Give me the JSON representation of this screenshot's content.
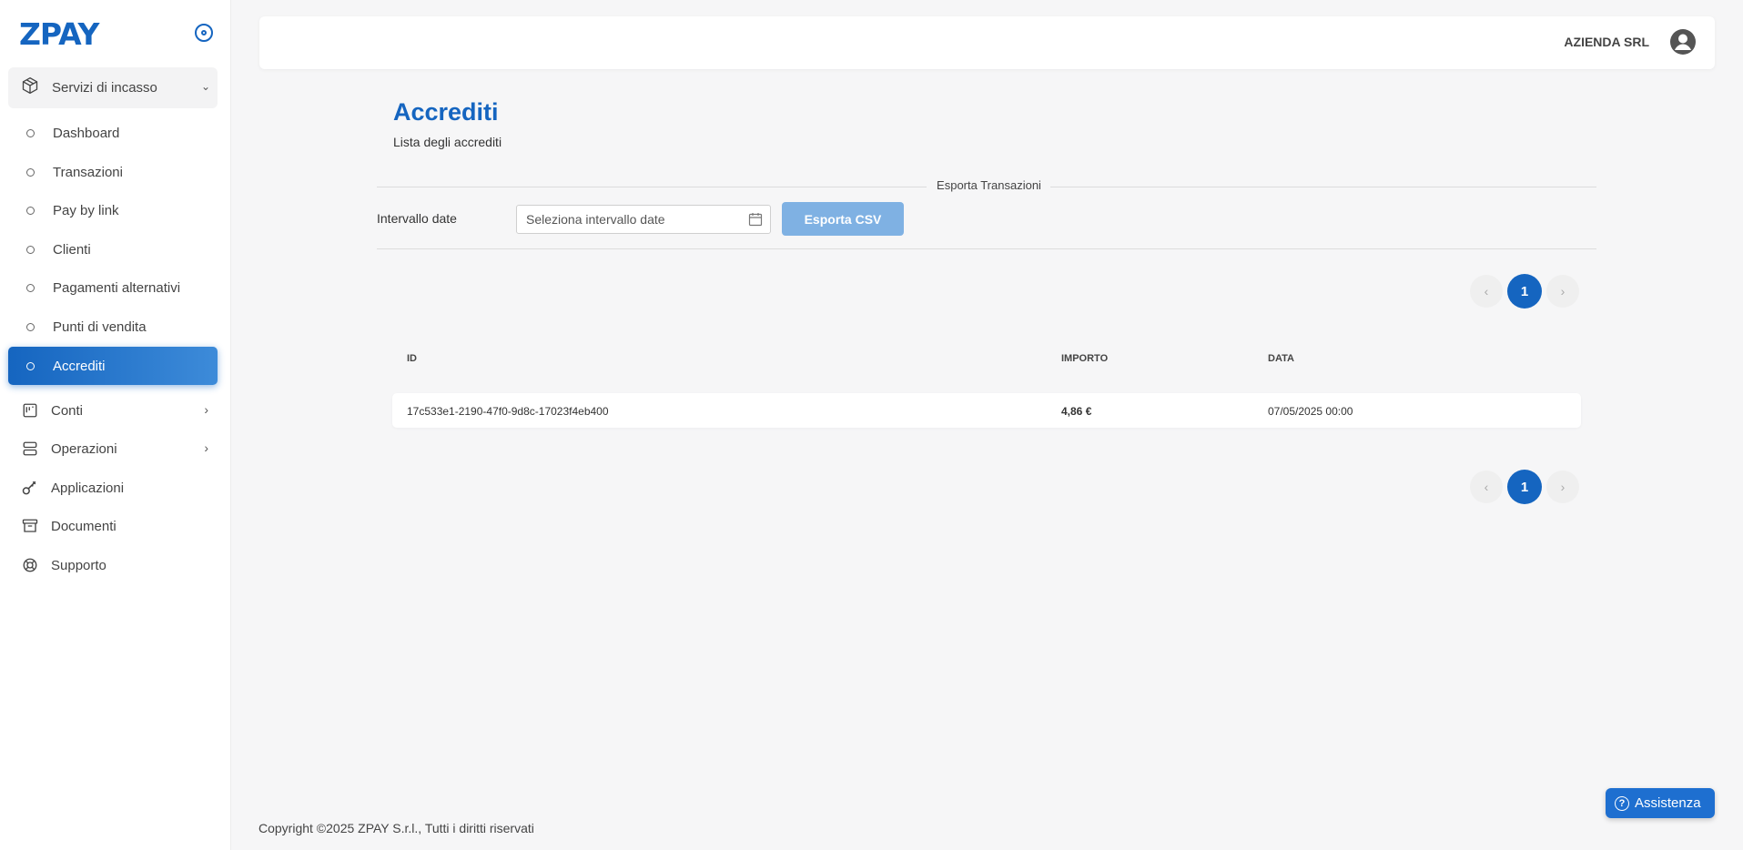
{
  "app": {
    "logo_text": "ZPAY"
  },
  "sidebar": {
    "group": {
      "label": "Servizi di incasso",
      "icon": "box-icon"
    },
    "subitems": [
      {
        "label": "Dashboard"
      },
      {
        "label": "Transazioni"
      },
      {
        "label": "Pay by link"
      },
      {
        "label": "Clienti"
      },
      {
        "label": "Pagamenti alternativi"
      },
      {
        "label": "Punti di vendita"
      },
      {
        "label": "Accrediti",
        "active": true
      }
    ],
    "items": [
      {
        "label": "Conti",
        "icon": "board-icon",
        "has_submenu": true
      },
      {
        "label": "Operazioni",
        "icon": "server-icon",
        "has_submenu": true
      },
      {
        "label": "Applicazioni",
        "icon": "key-icon"
      },
      {
        "label": "Documenti",
        "icon": "archive-icon"
      },
      {
        "label": "Supporto",
        "icon": "lifebuoy-icon"
      }
    ]
  },
  "header": {
    "user_name": "AZIENDA SRL"
  },
  "page": {
    "title": "Accrediti",
    "subtitle": "Lista degli accrediti",
    "export_section_title": "Esporta Transazioni",
    "date_range_label": "Intervallo date",
    "date_range_placeholder": "Seleziona intervallo date",
    "export_button": "Esporta CSV"
  },
  "pagination": {
    "current_page": "1",
    "prev": "‹",
    "next": "›"
  },
  "table": {
    "columns": [
      "ID",
      "IMPORTO",
      "DATA"
    ],
    "rows": [
      {
        "id": "17c533e1-2190-47f0-9d8c-17023f4eb400",
        "importo": "4,86 €",
        "data": "07/05/2025 00:00"
      }
    ]
  },
  "footer": {
    "copyright": "Copyright ©2025 ZPAY S.r.l., Tutti i diritti riservati"
  },
  "help": {
    "label": "Assistenza"
  },
  "colors": {
    "brand": "#1565c0",
    "export_button": "#7fb1e3",
    "help_button": "#1e6fd0"
  }
}
